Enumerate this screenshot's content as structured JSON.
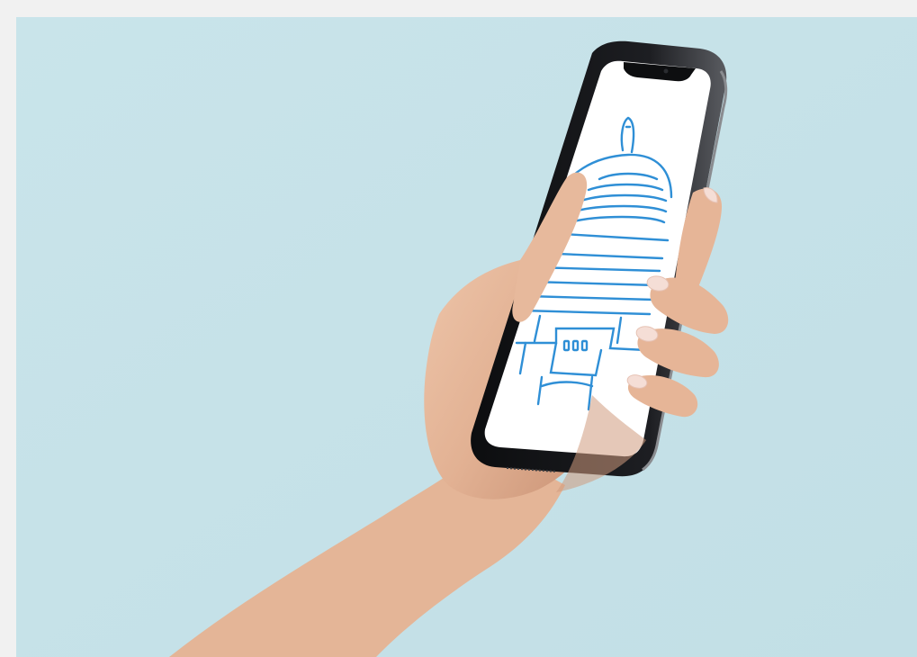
{
  "page": {
    "background_color": "#f1f1f1"
  },
  "photo": {
    "subject": "hand-holding-smartphone",
    "background_color": "#c6e2e8",
    "phone_body_color": "#17181b",
    "screen_color": "#ffffff",
    "illustration_color": "#2f8fd6",
    "skin_color": "#e7b99c"
  }
}
